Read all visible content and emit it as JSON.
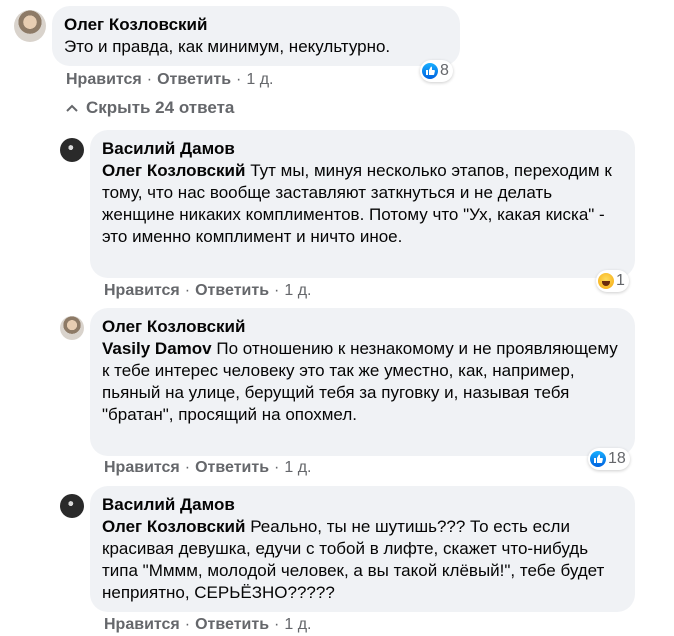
{
  "comments": [
    {
      "author": "Олег Козловский",
      "text": "Это и правда, как минимум, некультурно.",
      "like": "Нравится",
      "reply": "Ответить",
      "time": "1 д.",
      "reaction": {
        "icon": "like-icon",
        "count": "8"
      }
    },
    {
      "author": "Василий Дамов",
      "mention": "Олег Козловский",
      "text": "Тут мы, минуя несколько этапов, переходим к тому, что нас вообще заставляют заткнуться и не делать женщине никаких комплиментов. Потому что \"Ух, какая киска\" - это именно комплимент и ничто иное.",
      "like": "Нравится",
      "reply": "Ответить",
      "time": "1 д.",
      "reaction": {
        "icon": "haha-icon",
        "count": "1"
      }
    },
    {
      "author": "Олег Козловский",
      "mention": "Vasily Damov",
      "text": "По отношению к незнакомому и не проявляющему к тебе интерес человеку это так же уместно, как, например, пьяный на улице, берущий тебя за пуговку и, называя тебя \"братан\", просящий на опохмел.",
      "like": "Нравится",
      "reply": "Ответить",
      "time": "1 д.",
      "reaction": {
        "icon": "like-icon",
        "count": "18"
      }
    },
    {
      "author": "Василий Дамов",
      "mention": "Олег Козловский",
      "text": "Реально, ты не шутишь??? То есть если красивая девушка, едучи с тобой в лифте, скажет что-нибудь типа \"Мммм, молодой человек, а вы такой клёвый!\", тебе будет неприятно, СЕРЬЁЗНО?????",
      "like": "Нравится",
      "reply": "Ответить",
      "time": "1 д."
    }
  ],
  "hide_replies": "Скрыть 24 ответа",
  "colors": {
    "bubble": "#f0f2f5",
    "meta": "#65676b",
    "like_blue": "#1877f2"
  }
}
